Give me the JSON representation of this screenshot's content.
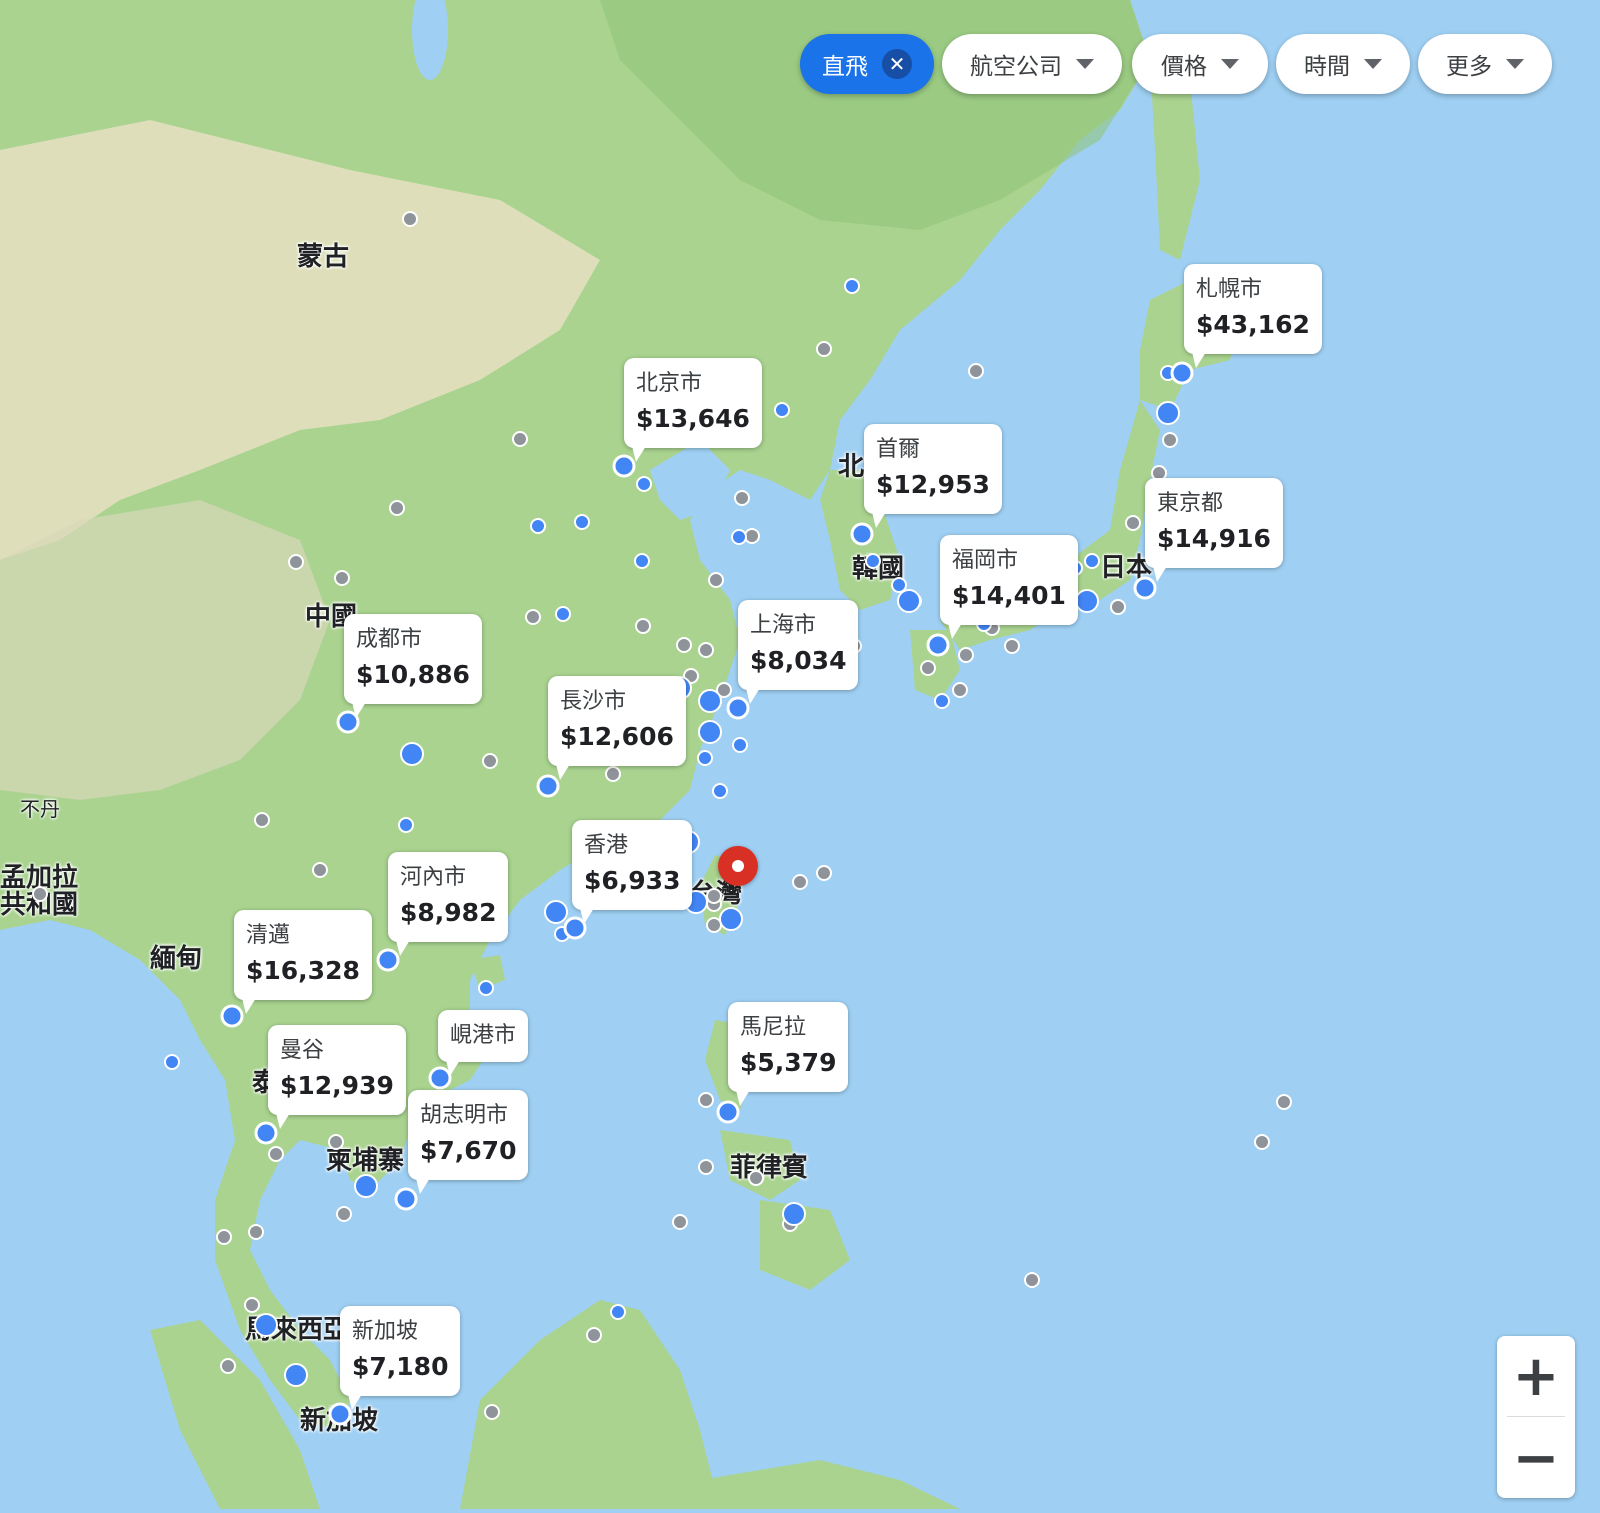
{
  "filters": {
    "nonstop": {
      "label": "直飛",
      "clear": "✕"
    },
    "airlines": {
      "label": "航空公司"
    },
    "price": {
      "label": "價格"
    },
    "times": {
      "label": "時間"
    },
    "more": {
      "label": "更多"
    }
  },
  "map": {
    "places": {
      "mongolia": "蒙古",
      "china": "中國",
      "bhutan": "不丹",
      "bangladesh_1": "孟加拉",
      "bangladesh_2": "共和國",
      "myanmar": "緬甸",
      "thailand": "泰國",
      "cambodia": "柬埔寨",
      "korea": "韓國",
      "north": "北",
      "japan": "日本",
      "philippines": "菲律賓",
      "malaysia": "馬來西亞",
      "singapore": "新加坡",
      "taiwan": "台灣"
    },
    "destinations": [
      {
        "city": "札幌市",
        "price": "$43,162"
      },
      {
        "city": "北京市",
        "price": "$13,646"
      },
      {
        "city": "首爾",
        "price": "$12,953"
      },
      {
        "city": "東京都",
        "price": "$14,916"
      },
      {
        "city": "福岡市",
        "price": "$14,401"
      },
      {
        "city": "上海市",
        "price": "$8,034"
      },
      {
        "city": "成都市",
        "price": "$10,886"
      },
      {
        "city": "長沙市",
        "price": "$12,606"
      },
      {
        "city": "香港",
        "price": "$6,933"
      },
      {
        "city": "河內市",
        "price": "$8,982"
      },
      {
        "city": "清邁",
        "price": "$16,328"
      },
      {
        "city": "峴港市",
        "price": ""
      },
      {
        "city": "曼谷",
        "price": "$12,939"
      },
      {
        "city": "胡志明市",
        "price": "$7,670"
      },
      {
        "city": "馬尼拉",
        "price": "$5,379"
      },
      {
        "city": "新加坡",
        "price": "$7,180"
      }
    ],
    "origin_color": "#d93025",
    "pin_color": "#4285f4",
    "water_color": "#9fd0f4",
    "land_color": "#a9d38f"
  },
  "zoom": {
    "in": "+",
    "out": "−"
  }
}
